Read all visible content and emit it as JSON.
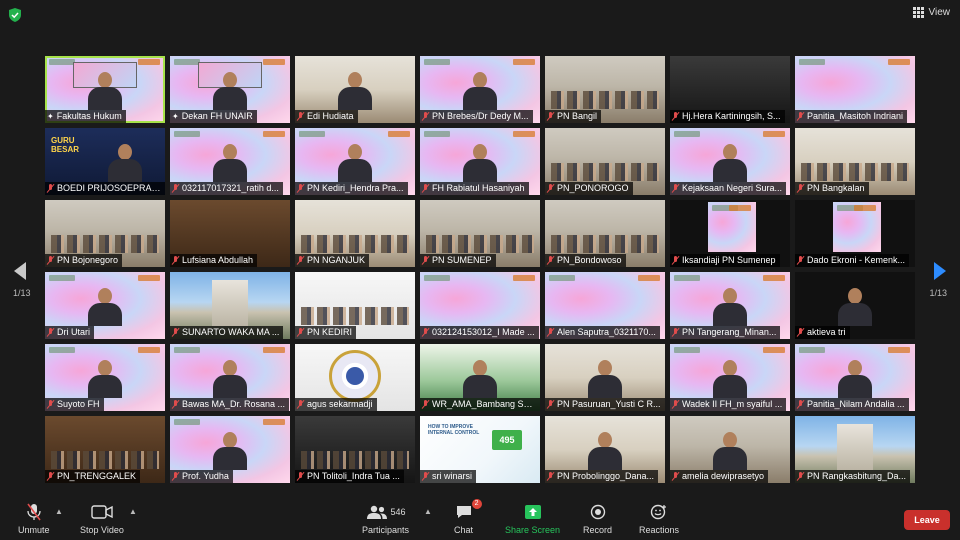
{
  "header": {
    "view_label": "View",
    "icons": [
      "shield-icon",
      "grid-view-icon"
    ]
  },
  "gallery": {
    "page_left": "1/13",
    "page_right": "1/13",
    "tiles": [
      {
        "name": "Fakultas Hukum",
        "bg": "zoom",
        "active": true,
        "muted": false,
        "figure": "screen"
      },
      {
        "name": "Dekan FH UNAIR",
        "bg": "zoom",
        "active": false,
        "muted": false,
        "figure": "screen"
      },
      {
        "name": "Edi Hudiata",
        "bg": "office",
        "active": false,
        "muted": true,
        "figure": "person"
      },
      {
        "name": "PN Brebes/Dr Dedy M...",
        "bg": "zoom",
        "active": false,
        "muted": true,
        "figure": "person"
      },
      {
        "name": "PN Bangil",
        "bg": "room",
        "active": false,
        "muted": true,
        "figure": "group"
      },
      {
        "name": "Hj.Hera Kartiningsih, S...",
        "bg": "dark",
        "active": false,
        "muted": true,
        "figure": "none"
      },
      {
        "name": "Panitia_Masitoh Indriani",
        "bg": "zoom",
        "active": false,
        "muted": true,
        "figure": "none"
      },
      {
        "name": "BOEDI PRIJOSOEPRAJI...",
        "bg": "banner",
        "active": false,
        "muted": true,
        "figure": "banner"
      },
      {
        "name": "032117017321_ratih d...",
        "bg": "zoom",
        "active": false,
        "muted": true,
        "figure": "person"
      },
      {
        "name": "PN Kediri_Hendra Pra...",
        "bg": "zoom",
        "active": false,
        "muted": true,
        "figure": "person"
      },
      {
        "name": "FH Rabiatul Hasaniyah",
        "bg": "zoom",
        "active": false,
        "muted": true,
        "figure": "person"
      },
      {
        "name": "PN_PONOROGO",
        "bg": "room",
        "active": false,
        "muted": true,
        "figure": "group"
      },
      {
        "name": "Kejaksaan Negeri Sura...",
        "bg": "zoom",
        "active": false,
        "muted": true,
        "figure": "person"
      },
      {
        "name": "PN Bangkalan",
        "bg": "office",
        "active": false,
        "muted": true,
        "figure": "group"
      },
      {
        "name": "PN Bojonegoro",
        "bg": "room",
        "active": false,
        "muted": true,
        "figure": "group"
      },
      {
        "name": "Lufsiana Abdullah",
        "bg": "wood",
        "active": false,
        "muted": true,
        "figure": "none"
      },
      {
        "name": "PN NGANJUK",
        "bg": "office",
        "active": false,
        "muted": true,
        "figure": "group"
      },
      {
        "name": "PN SUMENEP",
        "bg": "room",
        "active": false,
        "muted": true,
        "figure": "group"
      },
      {
        "name": "PN_Bondowoso",
        "bg": "room",
        "active": false,
        "muted": true,
        "figure": "group"
      },
      {
        "name": "Iksandiaji PN Sumenep",
        "bg": "black",
        "active": false,
        "muted": true,
        "figure": "zoomsmall"
      },
      {
        "name": "Dado Ekroni - Kemenk...",
        "bg": "black",
        "active": false,
        "muted": true,
        "figure": "zoomsmall"
      },
      {
        "name": "Dri Utari",
        "bg": "zoom",
        "active": false,
        "muted": true,
        "figure": "person"
      },
      {
        "name": "SUNARTO WAKA MA ...",
        "bg": "building",
        "active": false,
        "muted": true,
        "figure": "tower"
      },
      {
        "name": "PN KEDIRI",
        "bg": "white",
        "active": false,
        "muted": true,
        "figure": "group"
      },
      {
        "name": "032124153012_I Made ...",
        "bg": "zoom",
        "active": false,
        "muted": true,
        "figure": "none"
      },
      {
        "name": "Alen Saputra_0321170...",
        "bg": "zoom",
        "active": false,
        "muted": true,
        "figure": "none"
      },
      {
        "name": "PN Tangerang_Minan...",
        "bg": "zoom",
        "active": false,
        "muted": true,
        "figure": "person"
      },
      {
        "name": "aktieva tri",
        "bg": "black",
        "active": false,
        "muted": true,
        "figure": "person"
      },
      {
        "name": "Suyoto FH",
        "bg": "zoom",
        "active": false,
        "muted": true,
        "figure": "person"
      },
      {
        "name": "Bawas MA_Dr. Rosana ...",
        "bg": "zoom",
        "active": false,
        "muted": true,
        "figure": "person"
      },
      {
        "name": "agus sekarmadji",
        "bg": "white",
        "active": false,
        "muted": true,
        "figure": "emblem"
      },
      {
        "name": "WR_AMA_Bambang Se...",
        "bg": "green",
        "active": false,
        "muted": true,
        "figure": "person"
      },
      {
        "name": "PN Pasuruan_Yusti C R...",
        "bg": "office",
        "active": false,
        "muted": true,
        "figure": "person"
      },
      {
        "name": "Wadek II FH_m syaiful ...",
        "bg": "zoom",
        "active": false,
        "muted": true,
        "figure": "person"
      },
      {
        "name": "Panitia_Nilam Andalia ...",
        "bg": "zoom",
        "active": false,
        "muted": true,
        "figure": "person"
      },
      {
        "name": "PN_TRENGGALEK",
        "bg": "wood",
        "active": false,
        "muted": true,
        "figure": "group"
      },
      {
        "name": "Prof. Yudha",
        "bg": "zoom",
        "active": false,
        "muted": true,
        "figure": "person"
      },
      {
        "name": "PN Tolitoli_Indra Tua ...",
        "bg": "dark",
        "active": false,
        "muted": true,
        "figure": "group"
      },
      {
        "name": "sri winarsi",
        "bg": "slide",
        "active": false,
        "muted": true,
        "figure": "slide"
      },
      {
        "name": "PN Probolinggo_Dana...",
        "bg": "office",
        "active": false,
        "muted": true,
        "figure": "person"
      },
      {
        "name": "amelia dewiprasetyo",
        "bg": "room",
        "active": false,
        "muted": true,
        "figure": "person"
      },
      {
        "name": "PN Rangkasbitung_Da...",
        "bg": "building",
        "active": false,
        "muted": true,
        "figure": "tower"
      }
    ],
    "slide_text": "HOW TO IMPROVE INTERNAL CONTROL",
    "slide_number": "495",
    "banner_text": "GURU BESAR"
  },
  "toolbar": {
    "unmute_label": "Unmute",
    "stop_video_label": "Stop Video",
    "participants_label": "Participants",
    "participants_count": "546",
    "chat_label": "Chat",
    "chat_badge": "2",
    "share_screen_label": "Share Screen",
    "record_label": "Record",
    "reactions_label": "Reactions",
    "leave_label": "Leave"
  },
  "colors": {
    "accent_blue": "#2d8cff",
    "share_green": "#27c45c",
    "leave_red": "#c9302c",
    "active_speaker": "#a7e34a"
  }
}
